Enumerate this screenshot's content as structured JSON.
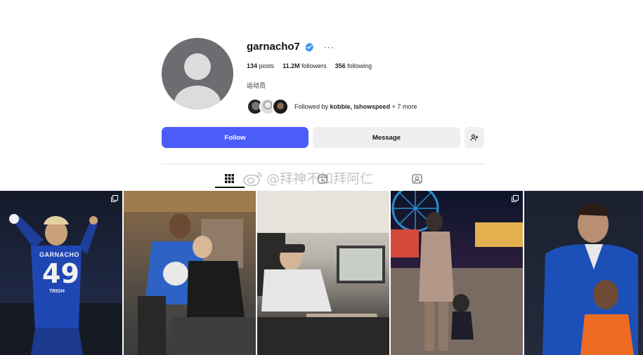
{
  "profile": {
    "username": "garnacho7",
    "verified_icon": "verified-badge-icon",
    "more_icon": "more-options-icon",
    "more_glyph": "···",
    "stats": {
      "posts_value": "134",
      "posts_label": "posts",
      "followers_value": "11.2M",
      "followers_label": "followers",
      "following_value": "356",
      "following_label": "following"
    },
    "bio": "运动员",
    "followed_by": {
      "prefix": "Followed by",
      "names": "kobbie, ishowspeed",
      "suffix": "+ 7 more"
    }
  },
  "actions": {
    "follow_label": "Follow",
    "message_label": "Message",
    "add_user_icon": "add-user-icon"
  },
  "tabs": {
    "posts_icon": "grid-icon",
    "reels_icon": "reels-icon",
    "tagged_icon": "tagged-icon"
  },
  "watermark": {
    "text": "@拜神不如拜阿仁",
    "icon": "weibo-icon"
  },
  "photos": {
    "p1": {
      "jersey_name": "GARNACHO",
      "jersey_number": "49",
      "sponsor": "TRIGH"
    }
  },
  "colors": {
    "accent": "#4a5df9",
    "verified": "#3897f0"
  }
}
